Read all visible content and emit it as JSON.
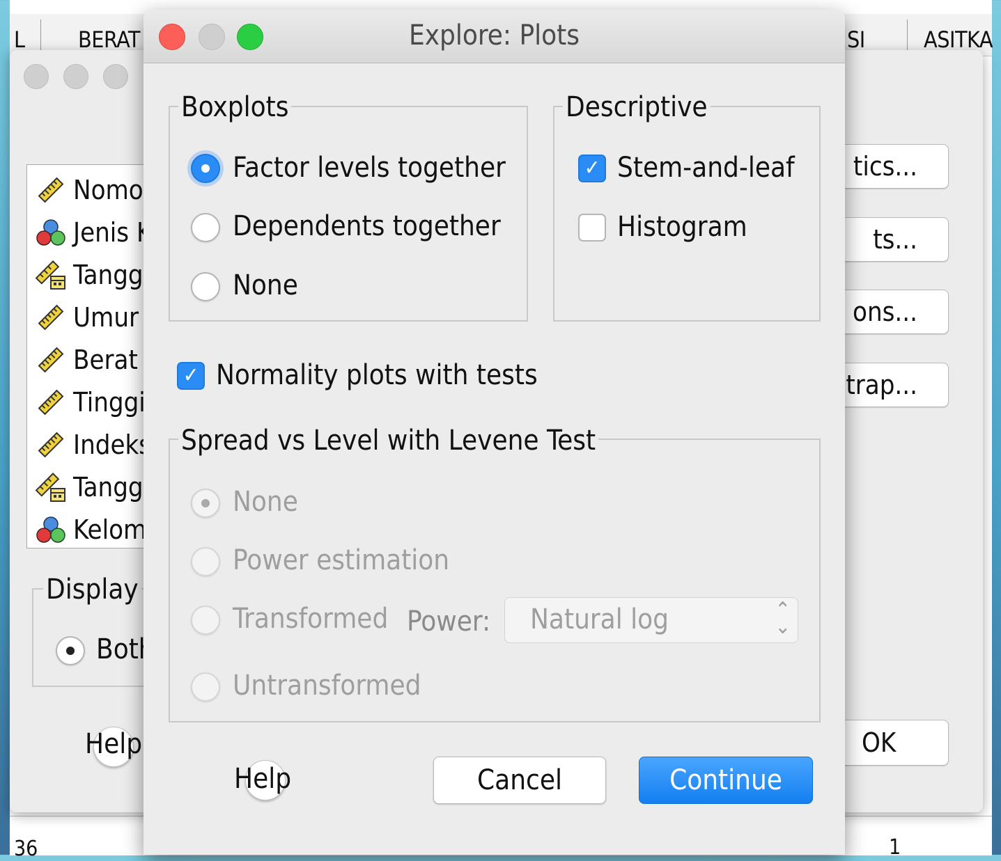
{
  "spreadsheet": {
    "columns": [
      {
        "label": "L"
      },
      {
        "label": "BERAT"
      },
      {
        "label": "SI"
      },
      {
        "label": "ASITKA"
      }
    ],
    "bottom_row": {
      "row_number": "36",
      "last_value": "1"
    }
  },
  "background_dialog": {
    "variables": [
      {
        "label": "Nomo",
        "icon": "ruler-scale-icon"
      },
      {
        "label": "Jenis K",
        "icon": "nominal-circles-icon"
      },
      {
        "label": "Tangg",
        "icon": "date-scale-icon"
      },
      {
        "label": "Umur",
        "icon": "ruler-scale-icon"
      },
      {
        "label": "Berat",
        "icon": "ruler-scale-icon"
      },
      {
        "label": "Tinggi",
        "icon": "ruler-scale-icon"
      },
      {
        "label": "Indeks",
        "icon": "ruler-scale-icon"
      },
      {
        "label": "Tangg",
        "icon": "date-scale-icon"
      },
      {
        "label": "Kelom",
        "icon": "nominal-circles-icon"
      }
    ],
    "side_buttons": [
      "tics...",
      "ts...",
      "ons...",
      "trap..."
    ],
    "display_group": {
      "title": "Display",
      "option": "Both"
    },
    "help_label": "Help",
    "ok_label": "OK"
  },
  "dialog": {
    "title": "Explore: Plots",
    "boxplots": {
      "title": "Boxplots",
      "options": [
        {
          "label": "Factor levels together",
          "selected": true
        },
        {
          "label": "Dependents together",
          "selected": false
        },
        {
          "label": "None",
          "selected": false
        }
      ]
    },
    "descriptive": {
      "title": "Descriptive",
      "options": [
        {
          "label": "Stem-and-leaf",
          "checked": true
        },
        {
          "label": "Histogram",
          "checked": false
        }
      ]
    },
    "normality": {
      "label": "Normality plots with tests",
      "checked": true
    },
    "spread": {
      "title": "Spread vs Level with Levene Test",
      "enabled": false,
      "options": [
        {
          "label": "None",
          "selected": true
        },
        {
          "label": "Power estimation",
          "selected": false
        },
        {
          "label": "Transformed",
          "selected": false
        },
        {
          "label": "Untransformed",
          "selected": false
        }
      ],
      "power_label": "Power:",
      "power_value": "Natural log"
    },
    "buttons": {
      "help": "Help",
      "cancel": "Cancel",
      "continue": "Continue"
    }
  },
  "colors": {
    "accent": "#2a8df5",
    "traffic_close": "#fc5f57",
    "traffic_min": "#cfcfcf",
    "traffic_max": "#2bcd42"
  }
}
